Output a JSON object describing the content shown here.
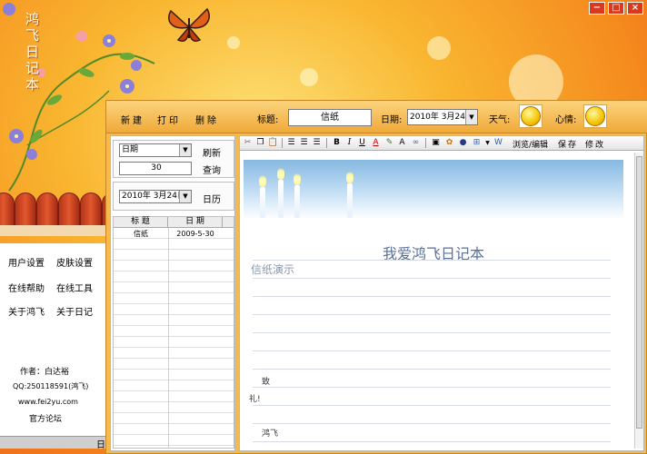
{
  "app": {
    "title": "鸿飞日记本",
    "window_controls": [
      "−",
      "□",
      "×"
    ]
  },
  "toolbar": {
    "new": "新建",
    "print": "打印",
    "delete": "删除",
    "title_label": "标题:",
    "title_value": "信纸",
    "date_label": "日期:",
    "date_value": "2010年 3月24日",
    "weather_label": "天气:",
    "mood_label": "心情:"
  },
  "search": {
    "field_select": "日期",
    "refresh": "刷新",
    "value": "30",
    "query": "查询",
    "date_value": "2010年 3月24日",
    "calendar": "日历"
  },
  "list": {
    "headers": [
      "标 题",
      "日 期"
    ],
    "rows": [
      {
        "title": "信纸",
        "date": "2009-5-30"
      }
    ]
  },
  "editor": {
    "tools": [
      "cut",
      "copy",
      "paste",
      "align-left",
      "align-center",
      "align-right",
      "bold",
      "italic",
      "underline",
      "font-color",
      "highlight",
      "font-size",
      "link",
      "image",
      "clip-art",
      "ball",
      "table",
      "word"
    ],
    "bold": "B",
    "italic": "I",
    "underline": "U",
    "font_color": "A",
    "font_size": "A",
    "browse_edit": "浏览/编辑",
    "save": "保存",
    "modify": "修改"
  },
  "letter": {
    "heading": "我爱鸿飞日记本",
    "demo": "信纸演示",
    "salute": "致",
    "regards": "礼!",
    "signature": "鸿飞"
  },
  "sidebar": {
    "items": [
      "用户设置",
      "皮肤设置",
      "在线帮助",
      "在线工具",
      "关于鸿飞",
      "关于日记"
    ],
    "author": "作者：白达裕",
    "qq": "QQ:250118591(鸿飞)",
    "website": "www.fei2yu.com",
    "forum": "官方论坛",
    "bottom": "日"
  },
  "colors": {
    "accent": "#f5a623",
    "heading": "#5a6f9a"
  }
}
